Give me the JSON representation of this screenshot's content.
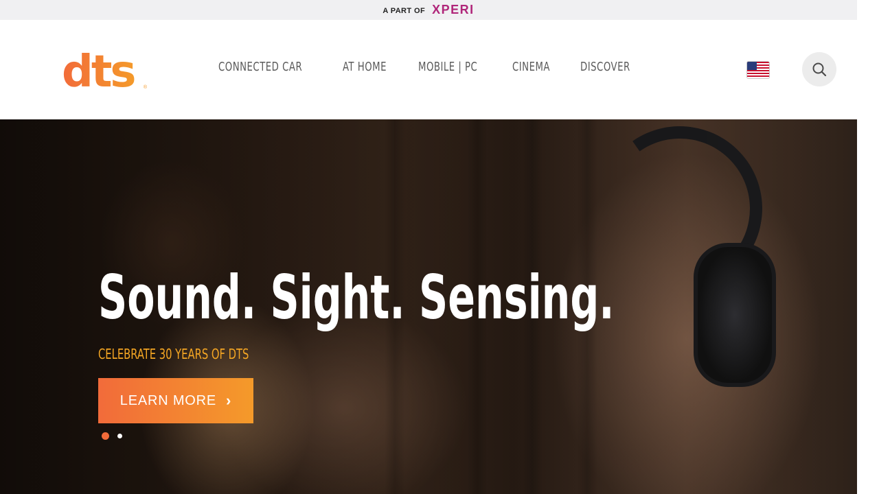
{
  "topbar": {
    "prefix": "A PART OF",
    "brand": "XPERI"
  },
  "header": {
    "logo_text": "dts",
    "logo_reg": "®",
    "nav": [
      {
        "label": "CONNECTED CAR"
      },
      {
        "label": "AT HOME"
      },
      {
        "label": "MOBILE | PC"
      },
      {
        "label": "CINEMA"
      },
      {
        "label": "DISCOVER"
      }
    ],
    "language_flag": "us-flag-icon",
    "search_icon": "search-icon"
  },
  "hero": {
    "title": "Sound. Sight. Sensing.",
    "subtitle": "CELEBRATE 30 YEARS OF DTS",
    "cta_label": "LEARN MORE",
    "cta_icon": "chevron-right-icon",
    "slides_count": 2,
    "active_slide": 1
  },
  "colors": {
    "accent_start": "#f26b3a",
    "accent_end": "#f49a2a",
    "subtitle": "#f5a623",
    "xperi": "#b0267a",
    "nav_text": "#5a5a5a",
    "topbar_bg": "#f0f0f2"
  }
}
